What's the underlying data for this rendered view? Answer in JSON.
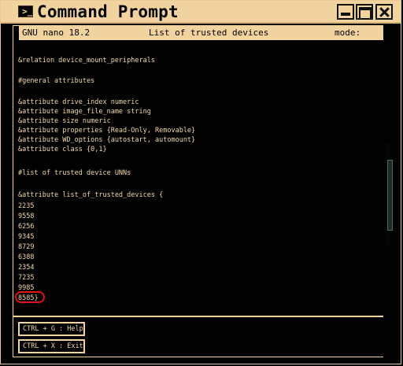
{
  "window": {
    "title": "Command Prompt",
    "terminal_icon": ">_",
    "icon_names": {
      "app": "terminal-icon",
      "minimize": "minimize-icon",
      "maximize": "maximize-icon",
      "close": "close-icon"
    },
    "colors": {
      "foreground": "#f3d9a8",
      "chrome": "#f1d3a0",
      "background": "#000000",
      "highlight": "#e21414"
    }
  },
  "nano": {
    "app": "GNU nano 18.2",
    "file_title": "List of trusted devices",
    "mode": "mode: edit"
  },
  "editor": {
    "lines": [
      "&relation device_mount_peripherals",
      "#general attributes",
      "&attribute drive_index numeric",
      "&attribute image_file_name string",
      "&attribute size numeric",
      "&attribute properties {Read-Only, Removable}",
      "&attribute WD_options {autostart, automount}",
      "&attribute class {0,1}",
      "#list of trusted device UNNs",
      "&attribute list_of_trusted_devices {",
      "2235",
      "9558",
      "6256",
      "9345",
      "8729",
      "6388",
      "2354",
      "7235",
      "9985",
      "8585}"
    ]
  },
  "help": {
    "help_label": "CTRL + G : Help",
    "exit_label": "CTRL + X : Exit"
  }
}
